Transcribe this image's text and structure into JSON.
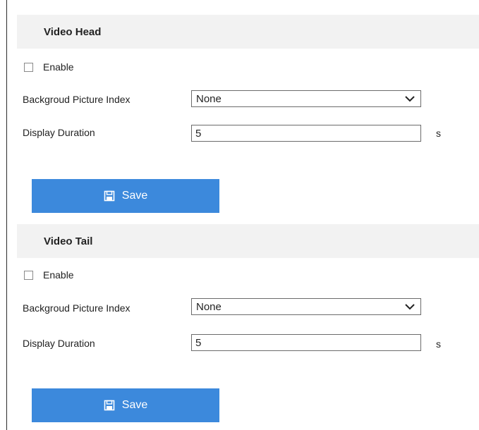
{
  "video_head": {
    "title": "Video Head",
    "enable_label": "Enable",
    "background_label": "Backgroud Picture Index",
    "background_value": "None",
    "duration_label": "Display Duration",
    "duration_value": "5",
    "duration_unit": "s",
    "save_label": "Save"
  },
  "video_tail": {
    "title": "Video Tail",
    "enable_label": "Enable",
    "background_label": "Backgroud Picture Index",
    "background_value": "None",
    "duration_label": "Display Duration",
    "duration_value": "5",
    "duration_unit": "s",
    "save_label": "Save"
  },
  "icons": {
    "save": "floppy-disk-icon",
    "dropdown": "chevron-down-icon"
  },
  "colors": {
    "accent": "#3c89dc",
    "header_bg": "#f2f2f2",
    "text": "#222222"
  }
}
